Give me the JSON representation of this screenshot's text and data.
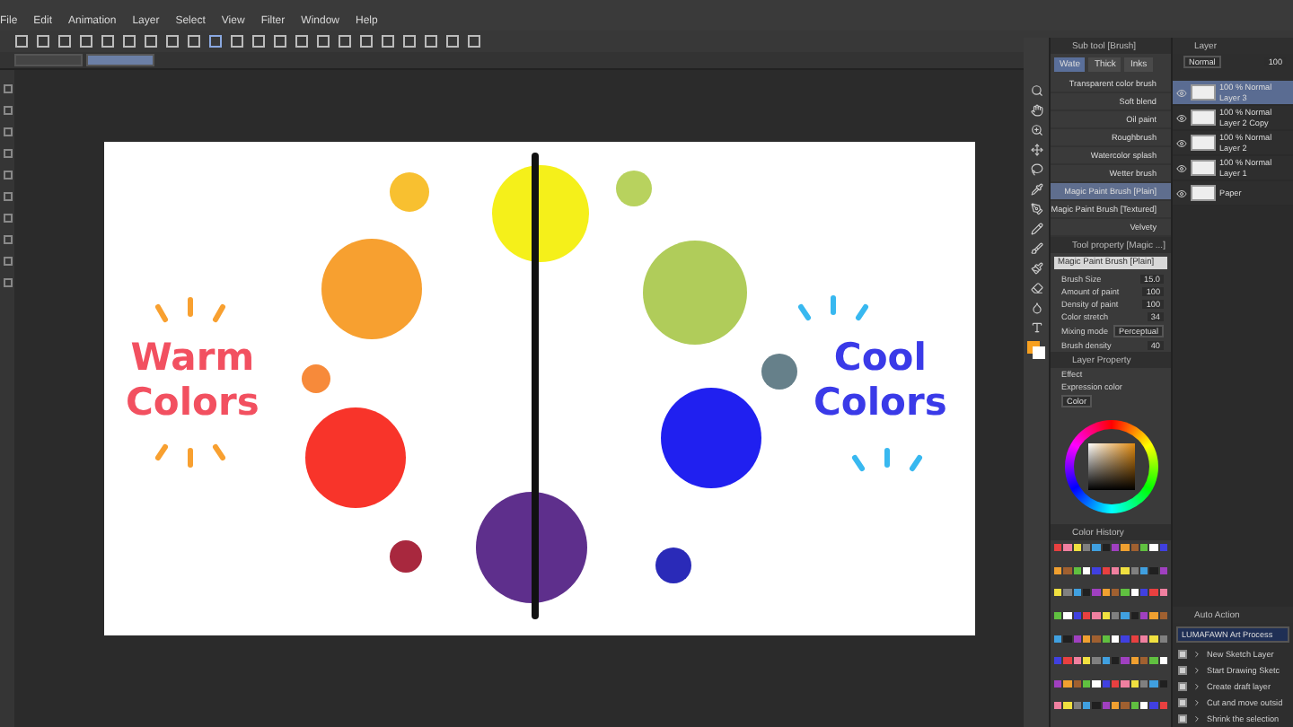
{
  "menu": [
    "File",
    "Edit",
    "Animation",
    "Layer",
    "Select",
    "View",
    "Filter",
    "Window",
    "Help"
  ],
  "sub_tool": {
    "title": "Sub tool [Brush]",
    "tabs": [
      {
        "label": "Wate",
        "selected": true
      },
      {
        "label": "Thick",
        "selected": false
      },
      {
        "label": "Inks",
        "selected": false
      }
    ],
    "items": [
      {
        "name": "Transparent color brush",
        "selected": false
      },
      {
        "name": "Soft blend",
        "selected": false
      },
      {
        "name": "Oil paint",
        "selected": false
      },
      {
        "name": "Roughbrush",
        "selected": false
      },
      {
        "name": "Watercolor splash",
        "selected": false
      },
      {
        "name": "Wetter brush",
        "selected": false
      },
      {
        "name": "Magic Paint Brush [Plain]",
        "selected": true
      },
      {
        "name": "Magic Paint Brush [Textured]",
        "selected": false
      },
      {
        "name": "Velvety",
        "selected": false
      }
    ]
  },
  "layers": {
    "title": "Layer",
    "blend_mode": "Normal",
    "opacity": "100",
    "items": [
      {
        "kind": "layer",
        "mode": "100 % Normal",
        "name": "Layer 3",
        "selected": true,
        "visible": true
      },
      {
        "kind": "layer",
        "mode": "100 % Normal",
        "name": "Layer 2 Copy",
        "selected": false,
        "visible": true
      },
      {
        "kind": "layer",
        "mode": "100 % Normal",
        "name": "Layer 2",
        "selected": false,
        "visible": true
      },
      {
        "kind": "layer",
        "mode": "100 % Normal",
        "name": "Layer 1",
        "selected": false,
        "visible": true
      },
      {
        "kind": "paper",
        "name": "Paper",
        "selected": false,
        "visible": true
      }
    ]
  },
  "tool_property": {
    "title": "Tool property [Magic ...]",
    "brush_name": "Magic Paint Brush [Plain]",
    "rows": [
      {
        "kind": "number",
        "label": "Brush Size",
        "value": "15.0"
      },
      {
        "kind": "number",
        "label": "Amount of paint",
        "value": "100"
      },
      {
        "kind": "number",
        "label": "Density of paint",
        "value": "100"
      },
      {
        "kind": "number",
        "label": "Color stretch",
        "value": "34"
      },
      {
        "kind": "select",
        "label": "Mixing mode",
        "value": "Perceptual"
      },
      {
        "kind": "number",
        "label": "Brush density",
        "value": "40"
      }
    ]
  },
  "layer_property": {
    "title": "Layer Property",
    "effect_label": "Effect",
    "expression_label": "Expression color",
    "expression_value": "Color"
  },
  "color_history": {
    "title": "Color History"
  },
  "auto_action": {
    "title": "Auto Action",
    "set": "LUMAFAWN Art Process",
    "items": [
      {
        "label": "New Sketch Layer",
        "checked": true
      },
      {
        "label": "Start Drawing Sketc",
        "checked": true
      },
      {
        "label": "Create draft layer",
        "checked": true
      },
      {
        "label": "Cut and move outsid",
        "checked": true
      },
      {
        "label": "Shrink the selection",
        "checked": true
      }
    ]
  },
  "canvas": {
    "left_label": [
      "Warm",
      "Colors"
    ],
    "right_label": [
      "Cool",
      "Colors"
    ]
  }
}
